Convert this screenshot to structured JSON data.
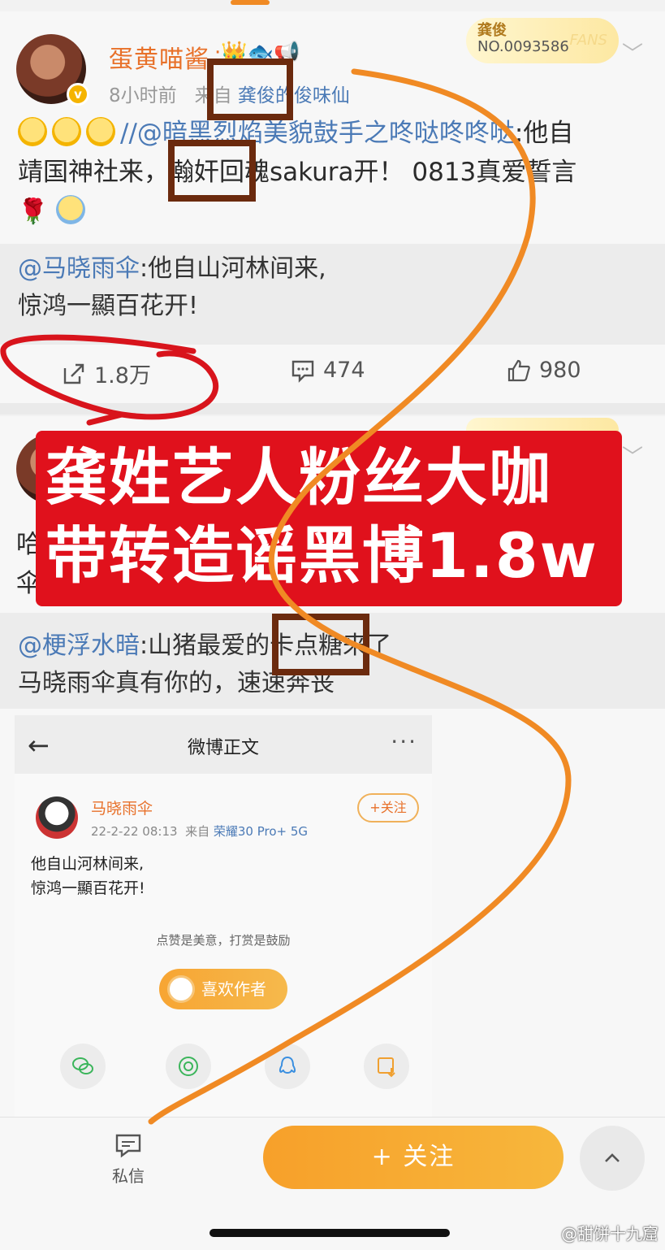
{
  "post1": {
    "user_name": "蛋黄喵酱",
    "user_badges": "·👑🐟📢",
    "time": "8小时前",
    "source_prefix": "来自",
    "source": "龚俊的俊味仙",
    "fans_badge": {
      "idol": "龚俊",
      "number": "NO.0093586",
      "label": "FANS"
    },
    "text_line1_mention": "//@暗黑烈焰美貌鼓手之咚哒咚咚哒",
    "text_line1_rest": ":他自",
    "text_line2": "靖国神社来，瀚奸回魂sakura开！ 0813真爱誓言",
    "quote_mention": "@马晓雨伞",
    "quote_line1": ":他自山河林间来,",
    "quote_line2": "惊鸿一顯百花开!",
    "repost_count": "1.8万",
    "comment_count": "474",
    "like_count": "980"
  },
  "post2": {
    "line1_partial": "哈",
    "line2_partial": "伞",
    "quote_mention": "@梗浮水暗",
    "quote_line1": ":山猪最爱的卡点糖来了",
    "quote_line2": "马晓雨伞真有你的，速速奔丧"
  },
  "banner": {
    "line1": "龚姓艺人粉丝大咖",
    "line2": "带转造谣黑博1.8w"
  },
  "embed": {
    "title": "微博正文",
    "more": "···",
    "user_name": "马晓雨伞",
    "time": "22-2-22 08:13",
    "source_prefix": "来自",
    "source": "荣耀30 Pro+ 5G",
    "follow_label": "+关注",
    "text_line1": "他自山河林间来,",
    "text_line2": "惊鸿一顯百花开!",
    "hint": "点赞是美意，打赏是鼓励",
    "like_author_label": "喜欢作者"
  },
  "bottom_bar": {
    "dm_label": "私信",
    "follow_label": "+ 关注"
  },
  "watermark": "@甜饼十九窟",
  "colors": {
    "accent_orange": "#f08a24",
    "mention_blue": "#4b7ab6",
    "banner_red": "#e0111c",
    "annotation_brown": "#6b2a0e",
    "annotation_red": "#d8141c"
  }
}
